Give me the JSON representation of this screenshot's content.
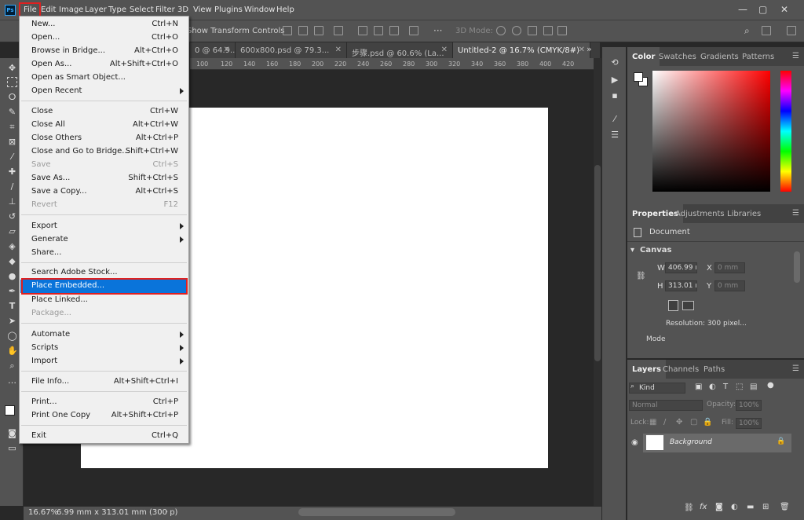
{
  "app": {
    "logo": "Ps"
  },
  "menubar": {
    "items": [
      "File",
      "Edit",
      "Image",
      "Layer",
      "Type",
      "Select",
      "Filter",
      "3D",
      "View",
      "Plugins",
      "Window",
      "Help"
    ],
    "window_controls": [
      "—",
      "▢",
      "✕"
    ]
  },
  "options_bar": {
    "transform_label": "Show Transform Controls",
    "mode_label": "3D Mode:"
  },
  "tabs": [
    {
      "label": "0 @ 64.9..."
    },
    {
      "label": "600x800.psd @ 79.3..."
    },
    {
      "label": "步骤.psd @ 60.6% (La..."
    },
    {
      "label": "Untitled-2 @ 16.7% (CMYK/8#)"
    }
  ],
  "ruler": {
    "ticks": [
      "100",
      "120",
      "140",
      "160",
      "180",
      "200",
      "220",
      "240",
      "260",
      "280",
      "300",
      "320",
      "340",
      "360",
      "380",
      "400",
      "420"
    ]
  },
  "file_menu": {
    "items": [
      {
        "label": "New...",
        "shortcut": "Ctrl+N"
      },
      {
        "label": "Open...",
        "shortcut": "Ctrl+O"
      },
      {
        "label": "Browse in Bridge...",
        "shortcut": "Alt+Ctrl+O"
      },
      {
        "label": "Open As...",
        "shortcut": "Alt+Shift+Ctrl+O"
      },
      {
        "label": "Open as Smart Object...",
        "shortcut": ""
      },
      {
        "label": "Open Recent",
        "shortcut": ""
      },
      {
        "label": "Close",
        "shortcut": "Ctrl+W"
      },
      {
        "label": "Close All",
        "shortcut": "Alt+Ctrl+W"
      },
      {
        "label": "Close Others",
        "shortcut": "Alt+Ctrl+P"
      },
      {
        "label": "Close and Go to Bridge...",
        "shortcut": "Shift+Ctrl+W"
      },
      {
        "label": "Save",
        "shortcut": "Ctrl+S"
      },
      {
        "label": "Save As...",
        "shortcut": "Shift+Ctrl+S"
      },
      {
        "label": "Save a Copy...",
        "shortcut": "Alt+Ctrl+S"
      },
      {
        "label": "Revert",
        "shortcut": "F12"
      },
      {
        "label": "Export",
        "shortcut": ""
      },
      {
        "label": "Generate",
        "shortcut": ""
      },
      {
        "label": "Share...",
        "shortcut": ""
      },
      {
        "label": "Search Adobe Stock...",
        "shortcut": ""
      },
      {
        "label": "Place Embedded...",
        "shortcut": ""
      },
      {
        "label": "Place Linked...",
        "shortcut": ""
      },
      {
        "label": "Package...",
        "shortcut": ""
      },
      {
        "label": "Automate",
        "shortcut": ""
      },
      {
        "label": "Scripts",
        "shortcut": ""
      },
      {
        "label": "Import",
        "shortcut": ""
      },
      {
        "label": "File Info...",
        "shortcut": "Alt+Shift+Ctrl+I"
      },
      {
        "label": "Print...",
        "shortcut": "Ctrl+P"
      },
      {
        "label": "Print One Copy",
        "shortcut": "Alt+Shift+Ctrl+P"
      },
      {
        "label": "Exit",
        "shortcut": "Ctrl+Q"
      }
    ]
  },
  "color_panel": {
    "tabs": [
      "Color",
      "Swatches",
      "Gradients",
      "Patterns"
    ],
    "accent": "#ff0000"
  },
  "properties_panel": {
    "tabs": [
      "Properties",
      "Adjustments",
      "Libraries"
    ],
    "document_label": "Document",
    "canvas_label": "Canvas",
    "w_label": "W",
    "w_value": "406.99 r",
    "h_label": "H",
    "h_value": "313.01 r",
    "x_label": "X",
    "x_placeholder": "0 mm",
    "y_label": "Y",
    "y_placeholder": "0 mm",
    "resolution": "Resolution: 300 pixel...",
    "mode_label": "Mode"
  },
  "layers_panel": {
    "tabs": [
      "Layers",
      "Channels",
      "Paths"
    ],
    "kind": "Kind",
    "blend_mode": "Normal",
    "opacity_label": "Opacity:",
    "opacity_value": "100%",
    "lock_label": "Lock:",
    "fill_label": "Fill:",
    "fill_value": "100%",
    "layer_name": "Background"
  },
  "status": {
    "zoom": "16.67%",
    "dimensions": "6.99 mm x 313.01 mm (300 p)"
  }
}
